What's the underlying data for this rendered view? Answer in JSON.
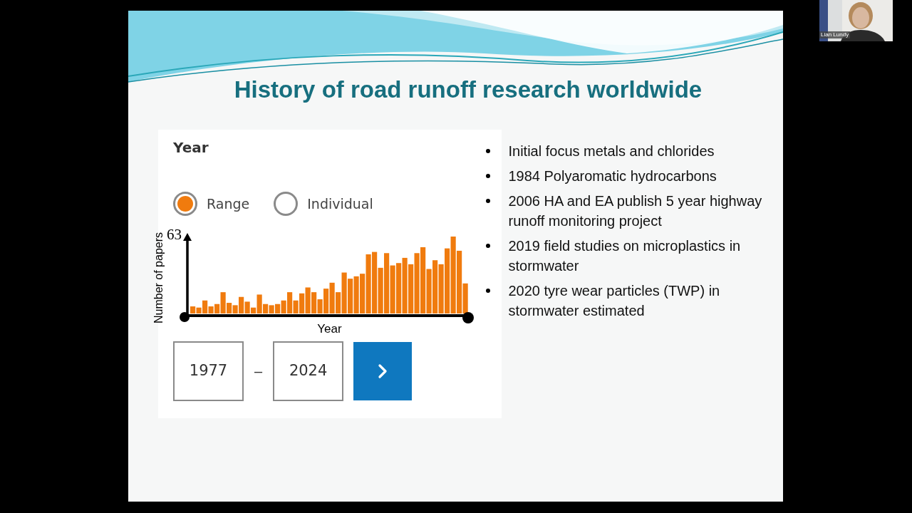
{
  "slide": {
    "title": "History of road runoff research worldwide",
    "year_filter": {
      "title": "Year",
      "modes": [
        {
          "label": "Range",
          "selected": true
        },
        {
          "label": "Individual",
          "selected": false
        }
      ],
      "chart": {
        "y_max_label": "63",
        "y_axis_label": "Number of papers",
        "x_axis_label": "Year"
      },
      "from": "1977",
      "separator": "–",
      "to": "2024"
    },
    "bullets": [
      "Initial focus metals and chlorides",
      "1984 Polyaromatic hydrocarbons",
      "2006 HA and EA publish 5 year highway runoff monitoring project",
      "2019 field studies on microplastics in stormwater",
      "2020 tyre wear particles (TWP) in stormwater estimated"
    ]
  },
  "participant": {
    "name": "Lian Lundy"
  }
}
